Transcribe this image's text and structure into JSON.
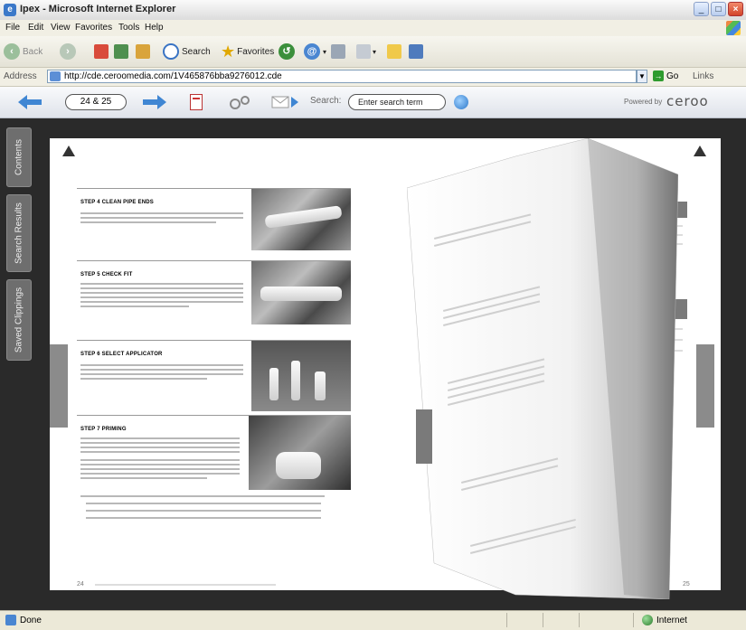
{
  "window": {
    "title": "Ipex - Microsoft Internet Explorer",
    "min": "_",
    "max": "□",
    "close": "×"
  },
  "menu": [
    "File",
    "Edit",
    "View",
    "Favorites",
    "Tools",
    "Help"
  ],
  "toolbar": {
    "back_label": "Back",
    "search_label": "Search",
    "favorites_label": "Favorites"
  },
  "address": {
    "label": "Address",
    "url": "http://cde.ceroomedia.com/1V465876bba9276012.cde",
    "go_label": "Go",
    "links_label": "Links"
  },
  "viewer": {
    "page_value": "24 & 25",
    "search_label": "Search:",
    "search_placeholder": "Enter search term",
    "powered_by": "Powered by",
    "brand": "ceroo"
  },
  "sidebar": {
    "tabs": [
      "Contents",
      "Search Results",
      "Saved Clippings"
    ]
  },
  "magazine": {
    "steps": [
      {
        "title": "STEP 4   CLEAN PIPE ENDS"
      },
      {
        "title": "STEP 5   CHECK FIT"
      },
      {
        "title": "STEP 6   SELECT APPLICATOR"
      },
      {
        "title": "STEP 7   PRIMING"
      }
    ],
    "page_left": "24",
    "page_right": "25"
  },
  "status": {
    "left": "Done",
    "zone": "Internet"
  },
  "colors": {
    "viewer_bg": "#2a2a2a",
    "accent_blue": "#2b77c9",
    "tab_gray": "#6e6e6e"
  }
}
